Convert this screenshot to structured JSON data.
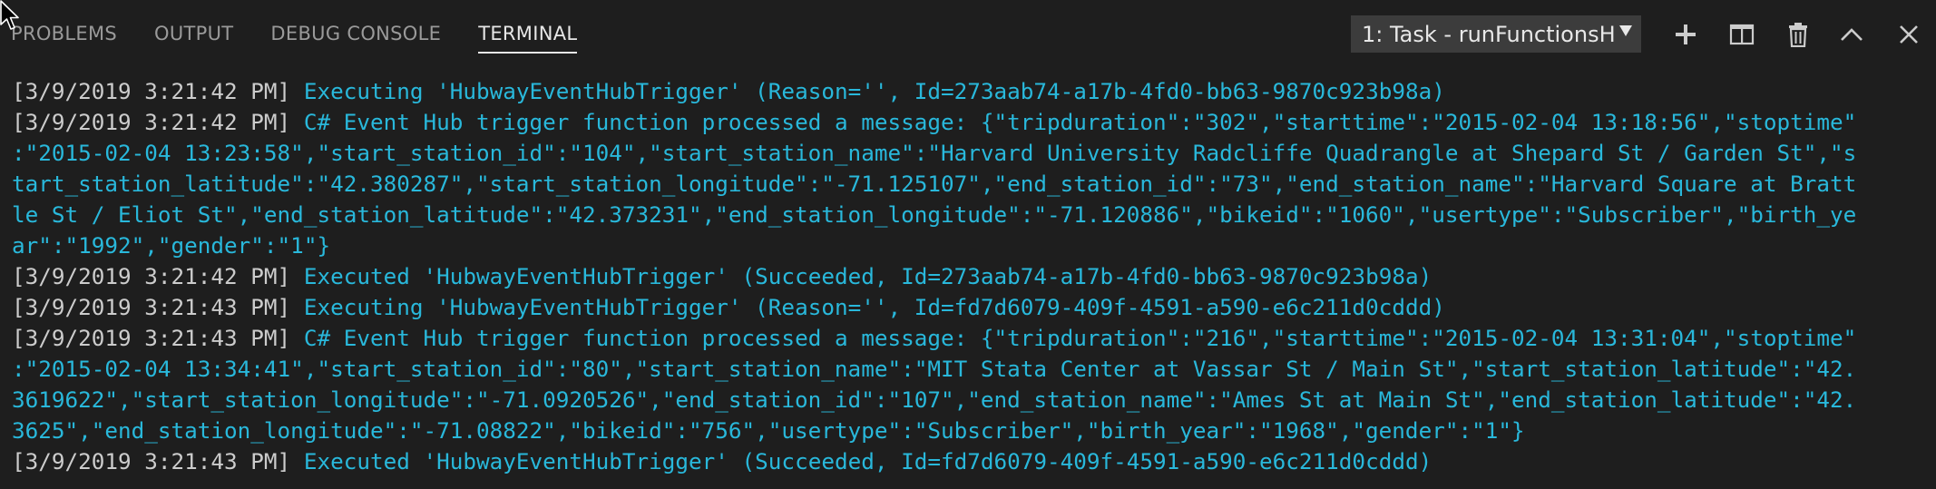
{
  "panel": {
    "tabs": [
      {
        "label": "PROBLEMS",
        "active": false
      },
      {
        "label": "OUTPUT",
        "active": false
      },
      {
        "label": "DEBUG CONSOLE",
        "active": false
      },
      {
        "label": "TERMINAL",
        "active": true
      }
    ],
    "terminal_select": {
      "selected": "1: Task - runFunctionsH"
    },
    "actions": [
      {
        "name": "new-terminal",
        "icon": "plus-icon"
      },
      {
        "name": "split-terminal",
        "icon": "split-icon"
      },
      {
        "name": "kill-terminal",
        "icon": "trash-icon"
      },
      {
        "name": "maximize-panel",
        "icon": "chevron-up-icon"
      },
      {
        "name": "close-panel",
        "icon": "close-icon"
      }
    ]
  },
  "terminal": {
    "lines": [
      {
        "ts": "[3/9/2019 3:21:42 PM] ",
        "msg": "Executing 'HubwayEventHubTrigger' (Reason='', Id=273aab74-a17b-4fd0-bb63-9870c923b98a)"
      },
      {
        "ts": "[3/9/2019 3:21:42 PM] ",
        "msg": "C# Event Hub trigger function processed a message: {\"tripduration\":\"302\",\"starttime\":\"2015-02-04 13:18:56\",\"stoptime\""
      },
      {
        "ts": "",
        "msg": ":\"2015-02-04 13:23:58\",\"start_station_id\":\"104\",\"start_station_name\":\"Harvard University Radcliffe Quadrangle at Shepard St / Garden St\",\"s"
      },
      {
        "ts": "",
        "msg": "tart_station_latitude\":\"42.380287\",\"start_station_longitude\":\"-71.125107\",\"end_station_id\":\"73\",\"end_station_name\":\"Harvard Square at Bratt"
      },
      {
        "ts": "",
        "msg": "le St / Eliot St\",\"end_station_latitude\":\"42.373231\",\"end_station_longitude\":\"-71.120886\",\"bikeid\":\"1060\",\"usertype\":\"Subscriber\",\"birth_ye"
      },
      {
        "ts": "",
        "msg": "ar\":\"1992\",\"gender\":\"1\"}"
      },
      {
        "ts": "[3/9/2019 3:21:42 PM] ",
        "msg": "Executed 'HubwayEventHubTrigger' (Succeeded, Id=273aab74-a17b-4fd0-bb63-9870c923b98a)"
      },
      {
        "ts": "[3/9/2019 3:21:43 PM] ",
        "msg": "Executing 'HubwayEventHubTrigger' (Reason='', Id=fd7d6079-409f-4591-a590-e6c211d0cddd)"
      },
      {
        "ts": "[3/9/2019 3:21:43 PM] ",
        "msg": "C# Event Hub trigger function processed a message: {\"tripduration\":\"216\",\"starttime\":\"2015-02-04 13:31:04\",\"stoptime\""
      },
      {
        "ts": "",
        "msg": ":\"2015-02-04 13:34:41\",\"start_station_id\":\"80\",\"start_station_name\":\"MIT Stata Center at Vassar St / Main St\",\"start_station_latitude\":\"42."
      },
      {
        "ts": "",
        "msg": "3619622\",\"start_station_longitude\":\"-71.0920526\",\"end_station_id\":\"107\",\"end_station_name\":\"Ames St at Main St\",\"end_station_latitude\":\"42."
      },
      {
        "ts": "",
        "msg": "3625\",\"end_station_longitude\":\"-71.08822\",\"bikeid\":\"756\",\"usertype\":\"Subscriber\",\"birth_year\":\"1968\",\"gender\":\"1\"}"
      },
      {
        "ts": "[3/9/2019 3:21:43 PM] ",
        "msg": "Executed 'HubwayEventHubTrigger' (Succeeded, Id=fd7d6079-409f-4591-a590-e6c211d0cddd)"
      }
    ]
  },
  "colors": {
    "background": "#1e1e1e",
    "timestamp": "#cccccc",
    "message": "#29b8db",
    "tab_active": "#e7e7e7",
    "tab_inactive": "#9a9a9a",
    "select_bg": "#3c3c3c"
  }
}
